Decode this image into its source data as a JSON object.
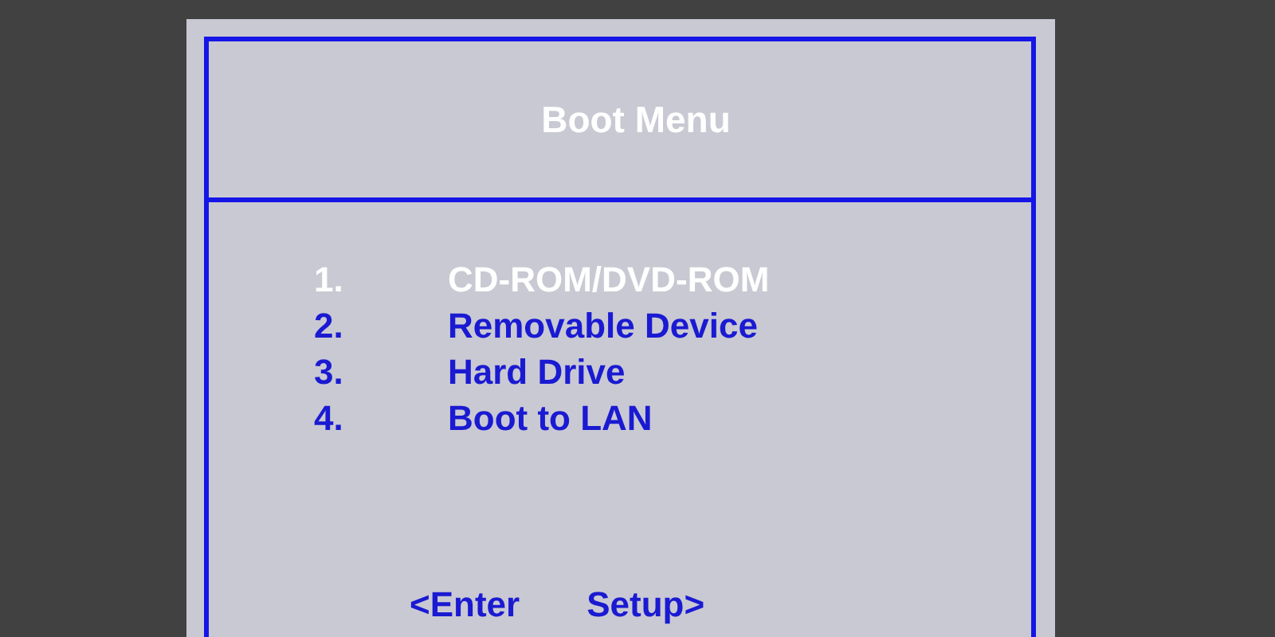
{
  "title": "Boot Menu",
  "items": [
    {
      "number": "1.",
      "label": "CD-ROM/DVD-ROM",
      "selected": true
    },
    {
      "number": "2.",
      "label": "Removable Device",
      "selected": false
    },
    {
      "number": "3.",
      "label": "Hard Drive",
      "selected": false
    },
    {
      "number": "4.",
      "label": "Boot to LAN",
      "selected": false
    }
  ],
  "footer": [
    "<Enter",
    "Setup>"
  ]
}
